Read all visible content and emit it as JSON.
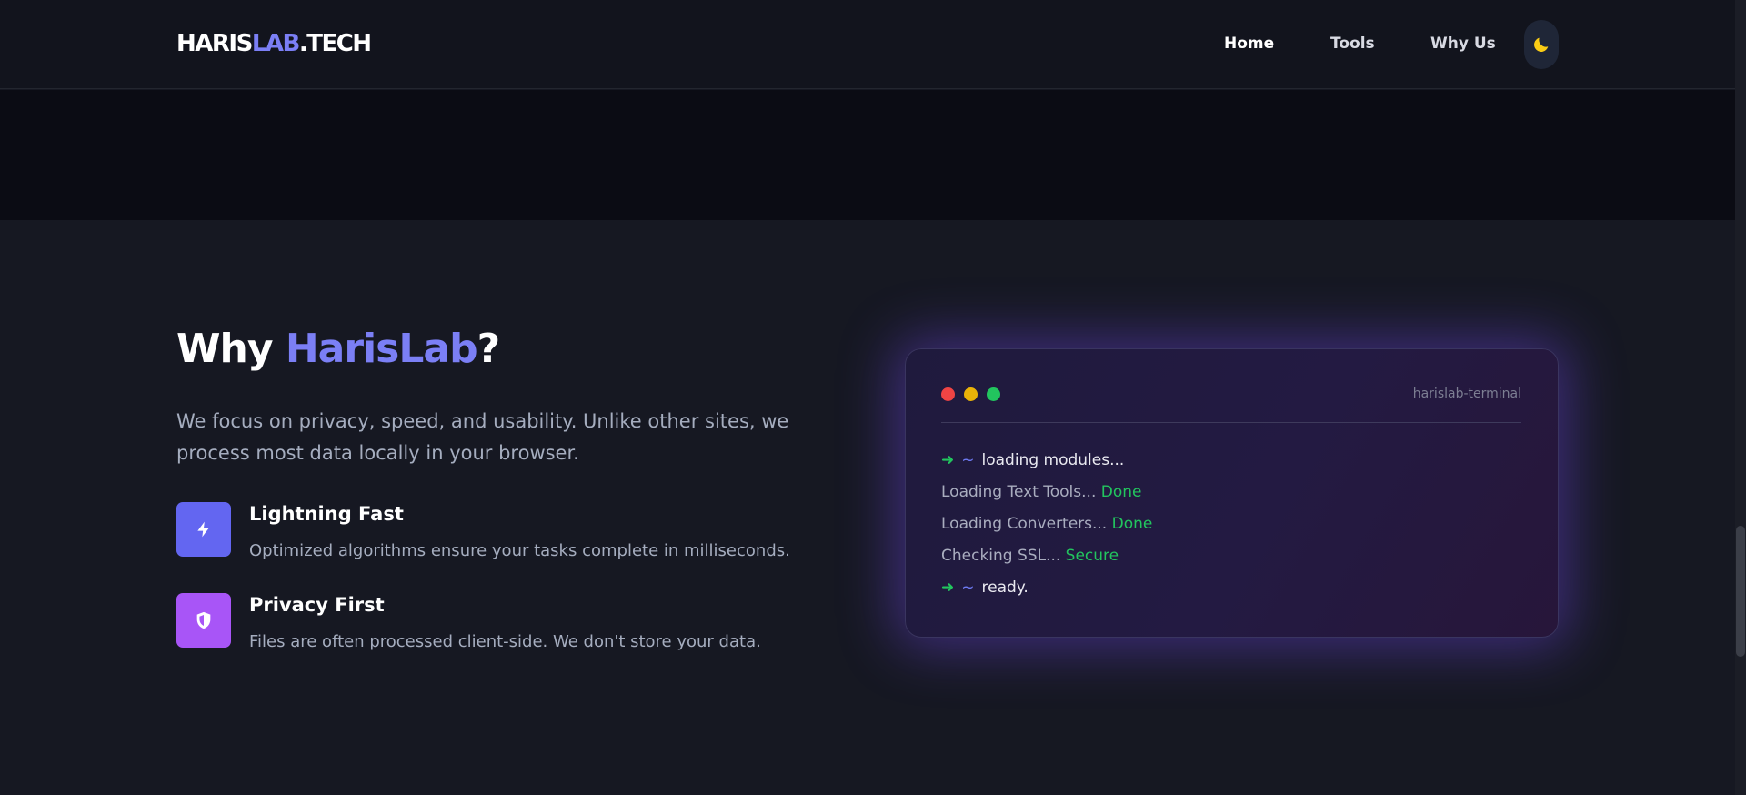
{
  "header": {
    "logo": {
      "part1": "HARIS",
      "part2": "LAB",
      "part3": ".TECH"
    },
    "nav": [
      {
        "label": "Home"
      },
      {
        "label": "Tools"
      },
      {
        "label": "Why Us"
      }
    ],
    "theme_toggle_icon": "moon-icon"
  },
  "why": {
    "title_prefix": "Why ",
    "title_accent": "HarisLab",
    "title_suffix": "?",
    "description": "We focus on privacy, speed, and usability. Unlike other sites, we process most data locally in your browser.",
    "features": [
      {
        "icon": "lightning-icon",
        "title": "Lightning Fast",
        "description": "Optimized algorithms ensure your tasks complete in milliseconds."
      },
      {
        "icon": "shield-icon",
        "title": "Privacy First",
        "description": "Files are often processed client-side. We don't store your data."
      }
    ]
  },
  "terminal": {
    "label": "harislab-terminal",
    "lines": [
      {
        "arrow": "➜",
        "tilde": "~",
        "text": "loading modules..."
      },
      {
        "text": "Loading Text Tools... ",
        "status": "Done"
      },
      {
        "text": "Loading Converters... ",
        "status": "Done"
      },
      {
        "text": "Checking SSL... ",
        "status": "Secure"
      },
      {
        "arrow": "➜",
        "tilde": "~",
        "text": "ready."
      }
    ]
  },
  "colors": {
    "accent": "#7b7ff5",
    "success": "#22c55e",
    "fast_icon_bg": "#6366f1",
    "privacy_icon_bg": "#a855f7",
    "moon": "#facc15"
  }
}
